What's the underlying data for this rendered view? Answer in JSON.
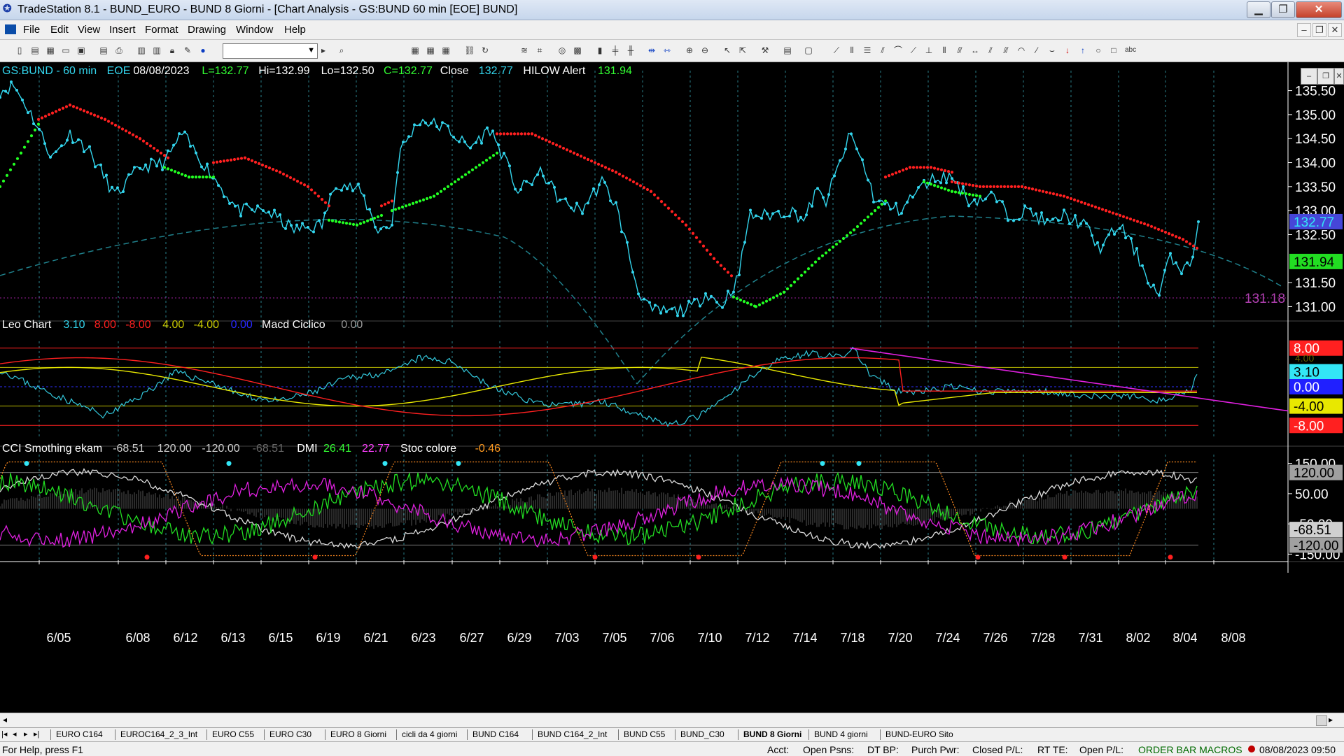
{
  "window": {
    "title": "TradeStation 8.1 - BUND_EURO - BUND 8 Giorni - [Chart Analysis - GS:BUND  60 min  [EOE] BUND]"
  },
  "menu": [
    "File",
    "Edit",
    "View",
    "Insert",
    "Format",
    "Drawing",
    "Window",
    "Help"
  ],
  "colors": {
    "bg": "#000000",
    "price": "#33d6ee",
    "red": "#ff2020",
    "green": "#22ff22",
    "yellow": "#e8e800",
    "magenta": "#e020e0",
    "axis": "#ffffff"
  },
  "price_panel": {
    "header": [
      {
        "text": "GS:BUND - 60 min",
        "color": "#33d6ee"
      },
      {
        "text": "EOE",
        "color": "#33d6ee"
      },
      {
        "text": "08/08/2023",
        "color": "#ffffff"
      },
      {
        "text": "L=132.77",
        "color": "#33ff33"
      },
      {
        "text": "Hi=132.99",
        "color": "#ffffff"
      },
      {
        "text": "Lo=132.50",
        "color": "#ffffff"
      },
      {
        "text": "C=132.77",
        "color": "#33ff33"
      },
      {
        "text": "Close",
        "color": "#ffffff"
      },
      {
        "text": "132.77",
        "color": "#33d6ee"
      },
      {
        "text": "HILOW Alert",
        "color": "#ffffff"
      },
      {
        "text": "131.94",
        "color": "#33ff33"
      }
    ],
    "y_ticks": [
      "135.50",
      "135.00",
      "134.50",
      "134.00",
      "133.50",
      "133.00",
      "132.50",
      "131.50",
      "131.00"
    ],
    "last_price": "132.77",
    "alert_price": "131.94",
    "support_label": "131.18"
  },
  "osc_panel": {
    "header": [
      {
        "text": "Leo Chart",
        "color": "#ffffff"
      },
      {
        "text": "3.10",
        "color": "#33d6ee"
      },
      {
        "text": "8.00",
        "color": "#ff2020"
      },
      {
        "text": "-8.00",
        "color": "#ff2020"
      },
      {
        "text": "4.00",
        "color": "#c8c800"
      },
      {
        "text": "-4.00",
        "color": "#c8c800"
      },
      {
        "text": "0.00",
        "color": "#2828ff"
      },
      {
        "text": "Macd Ciclico",
        "color": "#ffffff"
      },
      {
        "text": "0.00",
        "color": "#9a9a9a"
      }
    ],
    "labels": [
      {
        "text": "8.00",
        "bg": "#ff2020",
        "fg": "#ffffff"
      },
      {
        "text": "3.10",
        "bg": "#33e6f6",
        "fg": "#000000"
      },
      {
        "text": "0.00",
        "bg": "#2020ff",
        "fg": "#ffffff"
      },
      {
        "text": "-4.00",
        "bg": "#e8e800",
        "fg": "#000000"
      },
      {
        "text": "-8.00",
        "bg": "#ff2020",
        "fg": "#ffffff"
      }
    ],
    "partial_label": "4.00"
  },
  "cci_panel": {
    "header": [
      {
        "text": "CCI Smothing ekam",
        "color": "#ffffff"
      },
      {
        "text": "-68.51",
        "color": "#cfcfcf"
      },
      {
        "text": "120.00",
        "color": "#cfcfcf"
      },
      {
        "text": "-120.00",
        "color": "#cfcfcf"
      },
      {
        "text": "-68.51",
        "color": "#6a6a6a"
      },
      {
        "text": "DMI",
        "color": "#ffffff"
      },
      {
        "text": "26.41",
        "color": "#33ff33"
      },
      {
        "text": "22.77",
        "color": "#ff40ff"
      },
      {
        "text": "Stoc colore",
        "color": "#ffffff"
      },
      {
        "text": "-0.46",
        "color": "#ff9a20"
      }
    ],
    "y_ticks": [
      "150.00",
      "50.00",
      "-50.00",
      "-150.00"
    ],
    "labels": [
      {
        "text": "120.00",
        "bg": "#a0a0a0",
        "fg": "#000000"
      },
      {
        "text": "-68.51",
        "bg": "#d0d0d0",
        "fg": "#000000"
      },
      {
        "text": "-120.00",
        "bg": "#a0a0a0",
        "fg": "#000000"
      }
    ]
  },
  "x_ticks": [
    "6/05",
    "6/08",
    "6/12",
    "6/13",
    "6/15",
    "6/19",
    "6/21",
    "6/23",
    "6/27",
    "6/29",
    "7/03",
    "7/05",
    "7/06",
    "7/10",
    "7/12",
    "7/14",
    "7/18",
    "7/20",
    "7/24",
    "7/26",
    "7/28",
    "7/31",
    "8/02",
    "8/04",
    "8/08"
  ],
  "tabs": [
    "EURO C164",
    "EUROC164_2_3_Int",
    "EURO C55",
    "EURO C30",
    "EURO 8 Giorni",
    "cicli da 4 giorni",
    "BUND C164",
    "BUND C164_2_Int",
    "BUND C55",
    "BUND_C30",
    "BUND 8 Giorni",
    "BUND 4 giorni",
    "BUND-EURO Sito"
  ],
  "active_tab": "BUND 8 Giorni",
  "status": {
    "help": "For Help, press F1",
    "acct": "Acct:",
    "open_psns": "Open Psns:",
    "dt_bp": "DT BP:",
    "purch_pwr": "Purch Pwr:",
    "closed_pl": "Closed P/L:",
    "rt_te": "RT TE:",
    "open_pl": "Open P/L:",
    "macros": "ORDER BAR  MACROS",
    "datetime": "08/08/2023 09:50"
  },
  "chart_data": {
    "type": "line",
    "x": [
      "6/05",
      "6/08",
      "6/12",
      "6/13",
      "6/15",
      "6/19",
      "6/21",
      "6/23",
      "6/27",
      "6/29",
      "7/03",
      "7/05",
      "7/06",
      "7/10",
      "7/12",
      "7/14",
      "7/18",
      "7/20",
      "7/24",
      "7/26",
      "7/28",
      "7/31",
      "8/02",
      "8/04"
    ],
    "series": [
      {
        "name": "GS:BUND - 60 min",
        "values": [
          135.5,
          134.6,
          134.3,
          133.8,
          133.0,
          133.5,
          132.8,
          134.8,
          134.6,
          133.3,
          133.6,
          132.0,
          130.9,
          131.1,
          132.9,
          133.1,
          134.0,
          133.0,
          133.7,
          133.2,
          133.0,
          132.6,
          132.2,
          132.77
        ]
      }
    ],
    "ylim": [
      130.7,
      135.8
    ]
  }
}
